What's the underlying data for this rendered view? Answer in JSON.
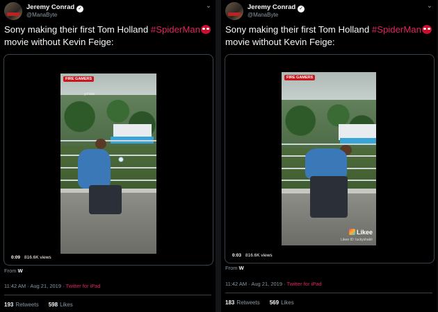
{
  "tweets": [
    {
      "author": "Jeremy Conrad",
      "handle": "@ManaByte",
      "verified_icon": "✓",
      "more_icon": "⌄",
      "text": "Sony making their first Tom Holland ",
      "hashtag": "#SpiderMan",
      "text_end": " movie without Kevin Feige:",
      "video": {
        "badge": "FIRE GAMERS",
        "watermark": "yshakir",
        "time": "0:09",
        "views": "816.6K views"
      },
      "from_label": "From",
      "from_value": "W",
      "time": "11:42 AM · Aug 21, 2019 · ",
      "source": "Twitter for iPad",
      "retweets": "193",
      "retweets_label": "Retweets",
      "likes": "598",
      "likes_label": "Likes"
    },
    {
      "author": "Jeremy Conrad",
      "handle": "@ManaByte",
      "verified_icon": "✓",
      "more_icon": "⌄",
      "text": "Sony making their first Tom Holland ",
      "hashtag": "#SpiderMan",
      "text_end": " movie without Kevin Feige:",
      "video": {
        "badge": "FIRE GAMERS",
        "likee": "Likee",
        "likee_id": "Likee ID: luckyshakir",
        "time": "0:03",
        "views": "816.6K views"
      },
      "from_label": "From",
      "from_value": "W",
      "time": "11:42 AM · Aug 21, 2019 · ",
      "source": "Twitter for iPad",
      "retweets": "183",
      "retweets_label": "Retweets",
      "likes": "569",
      "likes_label": "Likes"
    }
  ]
}
